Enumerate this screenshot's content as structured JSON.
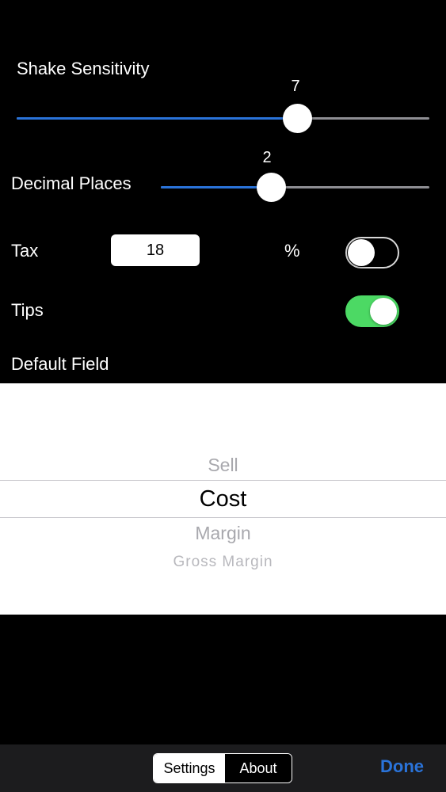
{
  "settings": {
    "shake_sensitivity": {
      "label": "Shake Sensitivity",
      "value": "7",
      "fraction": 0.68
    },
    "decimal_places": {
      "label": "Decimal Places",
      "value": "2",
      "fraction": 0.41
    },
    "tax": {
      "label": "Tax",
      "value": "18",
      "unit": "%",
      "toggle_on": false
    },
    "tips": {
      "label": "Tips",
      "toggle_on": true
    },
    "default_field": {
      "label": "Default Field"
    }
  },
  "picker": {
    "items": [
      "Sell",
      "Cost",
      "Margin",
      "Gross Margin"
    ],
    "selected": "Cost"
  },
  "bottom_bar": {
    "segments": [
      "Settings",
      "About"
    ],
    "selected_segment": "Settings",
    "done_label": "Done"
  },
  "colors": {
    "accent": "#2a73d9",
    "toggle_on": "#4cd964",
    "background": "#000000"
  }
}
